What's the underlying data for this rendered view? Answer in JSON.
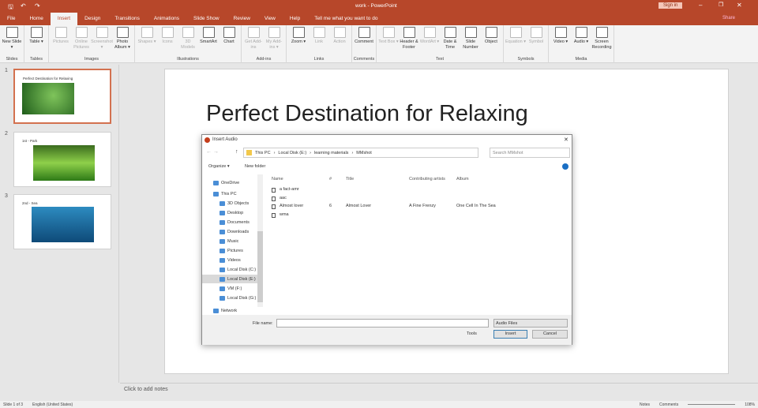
{
  "window": {
    "title": "work  -  PowerPoint",
    "sign_in": "Sign in",
    "share": "Share"
  },
  "tabs": [
    "File",
    "Home",
    "Insert",
    "Design",
    "Transitions",
    "Animations",
    "Slide Show",
    "Review",
    "View",
    "Help"
  ],
  "tell_me": "Tell me what you want to do",
  "ribbon": {
    "groups": [
      {
        "label": "Slides",
        "items": [
          {
            "l": "New Slide ▾",
            "d": false
          }
        ]
      },
      {
        "label": "Tables",
        "items": [
          {
            "l": "Table ▾",
            "d": false
          }
        ]
      },
      {
        "label": "Images",
        "items": [
          {
            "l": "Pictures",
            "d": true
          },
          {
            "l": "Online Pictures",
            "d": true
          },
          {
            "l": "Screenshot ▾",
            "d": true
          },
          {
            "l": "Photo Album ▾",
            "d": false
          }
        ]
      },
      {
        "label": "Illustrations",
        "items": [
          {
            "l": "Shapes ▾",
            "d": true
          },
          {
            "l": "Icons",
            "d": true
          },
          {
            "l": "3D Models",
            "d": true
          },
          {
            "l": "SmartArt",
            "d": false
          },
          {
            "l": "Chart",
            "d": false
          }
        ]
      },
      {
        "label": "Add-ins",
        "items": [
          {
            "l": "Get Add-ins",
            "d": true
          },
          {
            "l": "My Add-ins ▾",
            "d": true
          }
        ]
      },
      {
        "label": "Links",
        "items": [
          {
            "l": "Zoom ▾",
            "d": false
          },
          {
            "l": "Link",
            "d": true
          },
          {
            "l": "Action",
            "d": true
          }
        ]
      },
      {
        "label": "Comments",
        "items": [
          {
            "l": "Comment",
            "d": false
          }
        ]
      },
      {
        "label": "Text",
        "items": [
          {
            "l": "Text Box ▾",
            "d": true
          },
          {
            "l": "Header & Footer",
            "d": false
          },
          {
            "l": "WordArt ▾",
            "d": true
          },
          {
            "l": "Date & Time",
            "d": false
          },
          {
            "l": "Slide Number",
            "d": false
          },
          {
            "l": "Object",
            "d": false
          }
        ]
      },
      {
        "label": "Symbols",
        "items": [
          {
            "l": "Equation ▾",
            "d": true
          },
          {
            "l": "Symbol",
            "d": true
          }
        ]
      },
      {
        "label": "Media",
        "items": [
          {
            "l": "Video ▾",
            "d": false
          },
          {
            "l": "Audio ▾",
            "d": false
          },
          {
            "l": "Screen Recording",
            "d": false
          }
        ]
      }
    ]
  },
  "slides": [
    {
      "n": "1",
      "title": "Perfect Destination for Relaxing"
    },
    {
      "n": "2",
      "title": "1st - Park"
    },
    {
      "n": "3",
      "title": "2nd - Sea"
    }
  ],
  "slide_title": "Perfect Destination for Relaxing",
  "notes_placeholder": "Click to add notes",
  "status": {
    "slide": "Slide 1 of 3",
    "lang": "English (United States)",
    "notes": "Notes",
    "comments": "Comments",
    "zoom": "108%"
  },
  "dialog": {
    "title": "Insert Audio",
    "path": [
      "This PC",
      "Local Disk (E:)",
      "learning materials",
      "MMshot"
    ],
    "search_placeholder": "Search MMshot",
    "organize": "Organize ▾",
    "new_folder": "New folder",
    "nav": [
      "OneDrive",
      "This PC",
      "3D Objects",
      "Desktop",
      "Documents",
      "Downloads",
      "Music",
      "Pictures",
      "Videos",
      "Local Disk (C:)",
      "Local Disk (E:)",
      "VM (F:)",
      "Local Disk (G:)",
      "Network"
    ],
    "columns": [
      "Name",
      "#",
      "Title",
      "Contributing artists",
      "Album"
    ],
    "files": [
      {
        "name": "a fact-amr",
        "num": "",
        "title": "",
        "artist": "",
        "album": ""
      },
      {
        "name": "aac",
        "num": "",
        "title": "",
        "artist": "",
        "album": ""
      },
      {
        "name": "Almost lover",
        "num": "6",
        "title": "Almost Lover",
        "artist": "A Fine Frenzy",
        "album": "One Cell In The Sea"
      },
      {
        "name": "wma",
        "num": "",
        "title": "",
        "artist": "",
        "album": ""
      }
    ],
    "file_name_label": "File name:",
    "file_name": "",
    "file_type": "Audio Files",
    "tools": "Tools",
    "insert": "Insert",
    "cancel": "Cancel"
  }
}
